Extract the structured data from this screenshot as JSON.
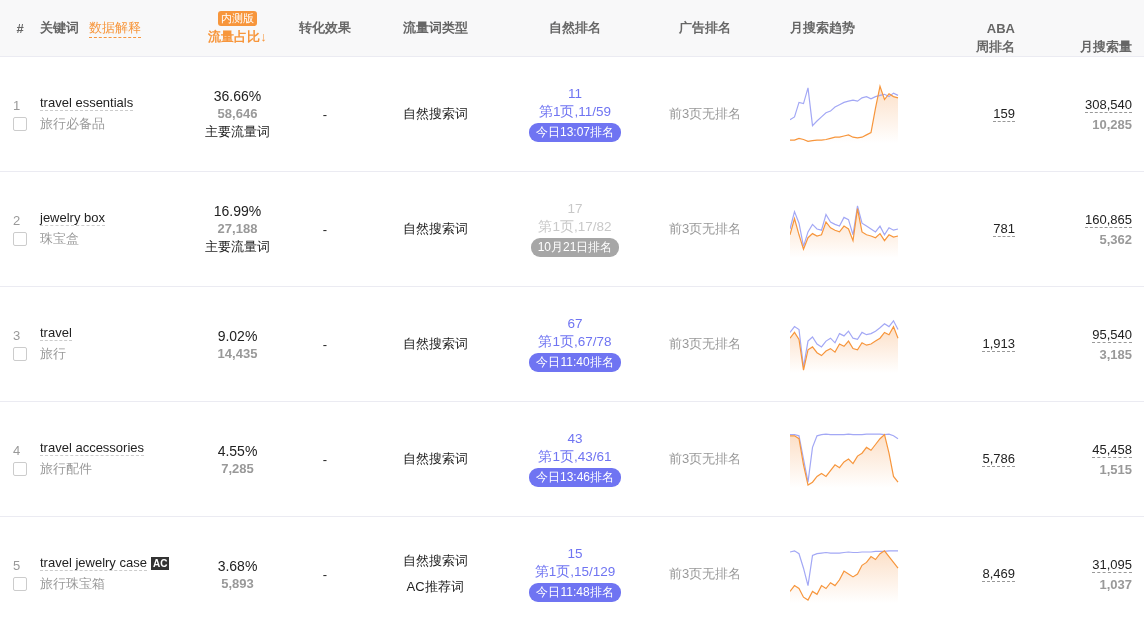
{
  "header": {
    "index": "#",
    "keyword": "关键词",
    "explain_link": "数据解释",
    "beta_badge": "内测版",
    "share": "流量占比↓",
    "conversion": "转化效果",
    "type": "流量词类型",
    "organic": "自然排名",
    "ad": "广告排名",
    "trend": "月搜索趋势",
    "aba_top": "ABA",
    "aba_bottom": "周排名",
    "volume": "月搜索量"
  },
  "rows": [
    {
      "index": "1",
      "keyword": "travel essentials",
      "translation": "旅行必备品",
      "ac_badge": null,
      "checked": false,
      "share": "36.66%",
      "share_count": "58,646",
      "share_tag": "主要流量词",
      "conversion": "-",
      "types": [
        "自然搜索词"
      ],
      "rank": "11",
      "rank_page": "第1页,11/59",
      "rank_time": "今日13:07排名",
      "rank_stale": false,
      "ad_rank": "前3页无排名",
      "aba": "159",
      "volume": "308,540",
      "volume_sub": "10,285"
    },
    {
      "index": "2",
      "keyword": "jewelry box",
      "translation": "珠宝盒",
      "ac_badge": null,
      "checked": false,
      "share": "16.99%",
      "share_count": "27,188",
      "share_tag": "主要流量词",
      "conversion": "-",
      "types": [
        "自然搜索词"
      ],
      "rank": "17",
      "rank_page": "第1页,17/82",
      "rank_time": "10月21日排名",
      "rank_stale": true,
      "ad_rank": "前3页无排名",
      "aba": "781",
      "volume": "160,865",
      "volume_sub": "5,362"
    },
    {
      "index": "3",
      "keyword": "travel",
      "translation": "旅行",
      "ac_badge": null,
      "checked": false,
      "share": "9.02%",
      "share_count": "14,435",
      "share_tag": null,
      "conversion": "-",
      "types": [
        "自然搜索词"
      ],
      "rank": "67",
      "rank_page": "第1页,67/78",
      "rank_time": "今日11:40排名",
      "rank_stale": false,
      "ad_rank": "前3页无排名",
      "aba": "1,913",
      "volume": "95,540",
      "volume_sub": "3,185"
    },
    {
      "index": "4",
      "keyword": "travel accessories",
      "translation": "旅行配件",
      "ac_badge": null,
      "checked": false,
      "share": "4.55%",
      "share_count": "7,285",
      "share_tag": null,
      "conversion": "-",
      "types": [
        "自然搜索词"
      ],
      "rank": "43",
      "rank_page": "第1页,43/61",
      "rank_time": "今日13:46排名",
      "rank_stale": false,
      "ad_rank": "前3页无排名",
      "aba": "5,786",
      "volume": "45,458",
      "volume_sub": "1,515"
    },
    {
      "index": "5",
      "keyword": "travel jewelry case",
      "translation": "旅行珠宝箱",
      "ac_badge": "AC",
      "checked": false,
      "share": "3.68%",
      "share_count": "5,893",
      "share_tag": null,
      "conversion": "-",
      "types": [
        "自然搜索词",
        "AC推荐词"
      ],
      "rank": "15",
      "rank_page": "第1页,15/129",
      "rank_time": "今日11:48排名",
      "rank_stale": false,
      "ad_rank": "前3页无排名",
      "aba": "8,469",
      "volume": "31,095",
      "volume_sub": "1,037"
    }
  ]
}
